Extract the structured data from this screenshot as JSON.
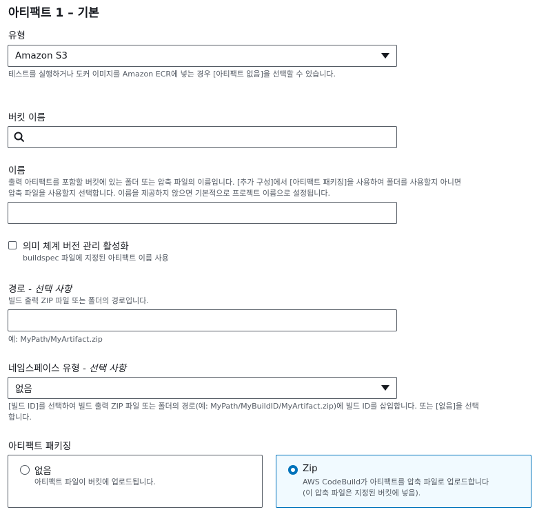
{
  "section": {
    "title": "아티팩트 1 – 기본"
  },
  "type_field": {
    "label": "유형",
    "selected": "Amazon S3",
    "description": "테스트를 실행하거나 도커 이미지를 Amazon ECR에 넣는 경우 [아티팩트 없음]을 선택할 수 있습니다."
  },
  "bucket_field": {
    "label": "버킷 이름",
    "value": "",
    "icon": "search-icon"
  },
  "name_field": {
    "label": "이름",
    "description_line1": "출력 아티팩트를 포함할 버킷에 있는 폴더 또는 압축 파일의 이름입니다. [추가 구성]에서 [아티팩트 패키징]을 사용하여 폴더를 사용할지 아니면",
    "description_line2": "압축 파일을 사용할지 선택합니다. 이름을 제공하지 않으면 기본적으로 프로젝트 이름으로 설정됩니다.",
    "value": ""
  },
  "semantic_versioning": {
    "label": "의미 체계 버전 관리 활성화",
    "description": "buildspec 파일에 지정된 아티팩트 이름 사용",
    "checked": false
  },
  "path_field": {
    "label": "경로 - ",
    "optional": "선택 사항",
    "description": "빌드 출력 ZIP 파일 또는 폴더의 경로입니다.",
    "value": "",
    "hint": "예: MyPath/MyArtifact.zip"
  },
  "namespace_field": {
    "label": "네임스페이스 유형 - ",
    "optional": "선택 사항",
    "selected": "없음",
    "description_line1": "[빌드 ID]를 선택하여 빌드 출력 ZIP 파일 또는 폴더의 경로(예: MyPath/MyBuildID/MyArtifact.zip)에 빌드 ID를 삽입합니다. 또는 [없음]을 선택",
    "description_line2": "합니다."
  },
  "packaging": {
    "label": "아티팩트 패키징",
    "options": [
      {
        "title": "없음",
        "description_line1": "아티팩트 파일이 버킷에 업로드됩니다.",
        "description_line2": "",
        "selected": false
      },
      {
        "title": "Zip",
        "description_line1": "AWS CodeBuild가 아티팩트를 압축 파일로 업로드합니다",
        "description_line2": "(이 압축 파일은 지정된 버킷에 넣음).",
        "selected": true
      }
    ]
  },
  "colors": {
    "accent": "#0073bb",
    "border": "#545b64",
    "text": "#16191f",
    "muted": "#545b64"
  }
}
